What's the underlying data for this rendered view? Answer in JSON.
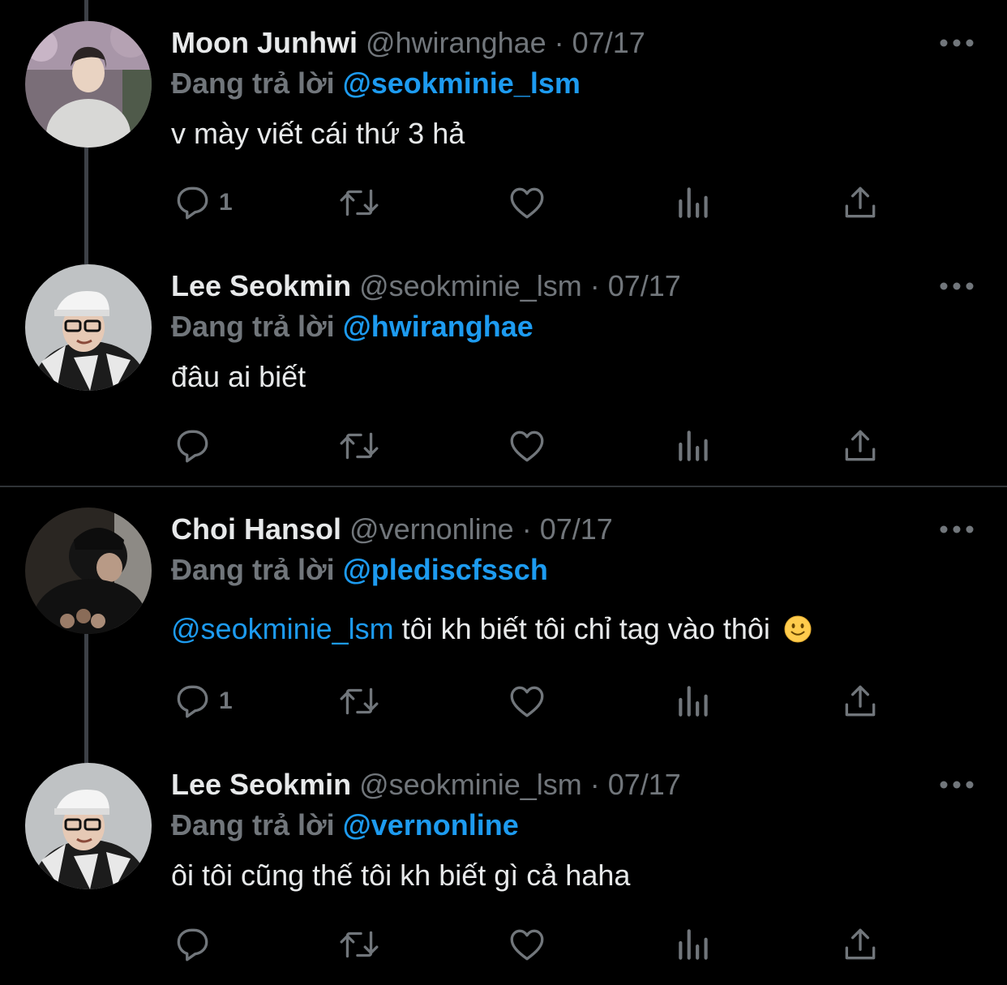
{
  "tweets": [
    {
      "name": "Moon Junhwi",
      "handle": "@hwiranghae",
      "separator": " · ",
      "date": "07/17",
      "reply_prefix": "Đang trả lời ",
      "reply_to": "@seokminie_lsm",
      "body_mention": "",
      "body": "v mày viết cái thứ 3 hả",
      "reply_count": "1",
      "avatar": "moon-junhwi-avatar"
    },
    {
      "name": "Lee Seokmin",
      "handle": "@seokminie_lsm",
      "separator": " · ",
      "date": "07/17",
      "reply_prefix": "Đang trả lời ",
      "reply_to": "@hwiranghae",
      "body_mention": "",
      "body": "đâu ai biết",
      "reply_count": "",
      "avatar": "lee-seokmin-avatar"
    },
    {
      "name": "Choi Hansol",
      "handle": "@vernonline",
      "separator": " · ",
      "date": "07/17",
      "reply_prefix": "Đang trả lời ",
      "reply_to": "@plediscfssch",
      "body_mention": "@seokminie_lsm",
      "body": " tôi kh biết tôi chỉ tag vào thôi",
      "reply_count": "1",
      "avatar": "choi-hansol-avatar"
    },
    {
      "name": "Lee Seokmin",
      "handle": "@seokminie_lsm",
      "separator": " · ",
      "date": "07/17",
      "reply_prefix": "Đang trả lời ",
      "reply_to": "@vernonline",
      "body_mention": "",
      "body": "ôi tôi cũng thế tôi kh biết gì cả haha",
      "reply_count": "",
      "avatar": "lee-seokmin-avatar"
    }
  ],
  "colors": {
    "background": "#000000",
    "text": "#e7e9ea",
    "secondary": "#71767b",
    "accent": "#1d9bf0",
    "thread_line": "#3d4147",
    "divider": "#2f3336"
  },
  "icons": [
    "reply-icon",
    "retweet-icon",
    "like-icon",
    "views-icon",
    "share-icon",
    "more-icon",
    "smile-emoji"
  ]
}
